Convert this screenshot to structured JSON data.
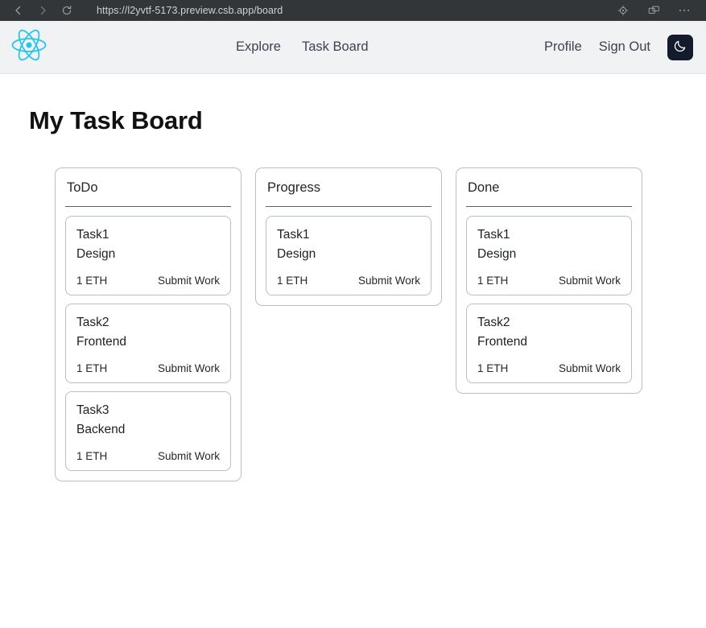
{
  "browser": {
    "url": "https://l2yvtf-5173.preview.csb.app/board",
    "back_icon": "chevron-left-icon",
    "forward_icon": "chevron-right-icon",
    "reload_icon": "reload-icon",
    "inspect_icon": "crosshair-target-icon",
    "split_icon": "split-window-icon",
    "more_icon": "more-options-icon"
  },
  "header": {
    "logo": "react-logo-icon",
    "logo_color": "#28c6e8",
    "nav": [
      {
        "label": "Explore",
        "name": "nav-link-explore"
      },
      {
        "label": "Task Board",
        "name": "nav-link-task-board"
      }
    ],
    "account": [
      {
        "label": "Profile",
        "name": "nav-link-profile"
      },
      {
        "label": "Sign Out",
        "name": "nav-link-sign-out"
      }
    ],
    "theme_toggle": {
      "icon": "moon-icon",
      "background": "#141b2d"
    }
  },
  "main": {
    "title": "My Task Board",
    "columns": [
      {
        "title": "ToDo",
        "tasks": [
          {
            "title": "Task1",
            "desc": "Design",
            "price": "1 ETH",
            "action": "Submit Work"
          },
          {
            "title": "Task2",
            "desc": "Frontend",
            "price": "1 ETH",
            "action": "Submit Work"
          },
          {
            "title": "Task3",
            "desc": "Backend",
            "price": "1 ETH",
            "action": "Submit Work"
          }
        ]
      },
      {
        "title": "Progress",
        "tasks": [
          {
            "title": "Task1",
            "desc": "Design",
            "price": "1 ETH",
            "action": "Submit Work"
          }
        ]
      },
      {
        "title": "Done",
        "tasks": [
          {
            "title": "Task1",
            "desc": "Design",
            "price": "1 ETH",
            "action": "Submit Work"
          },
          {
            "title": "Task2",
            "desc": "Frontend",
            "price": "1 ETH",
            "action": "Submit Work"
          }
        ]
      }
    ]
  }
}
